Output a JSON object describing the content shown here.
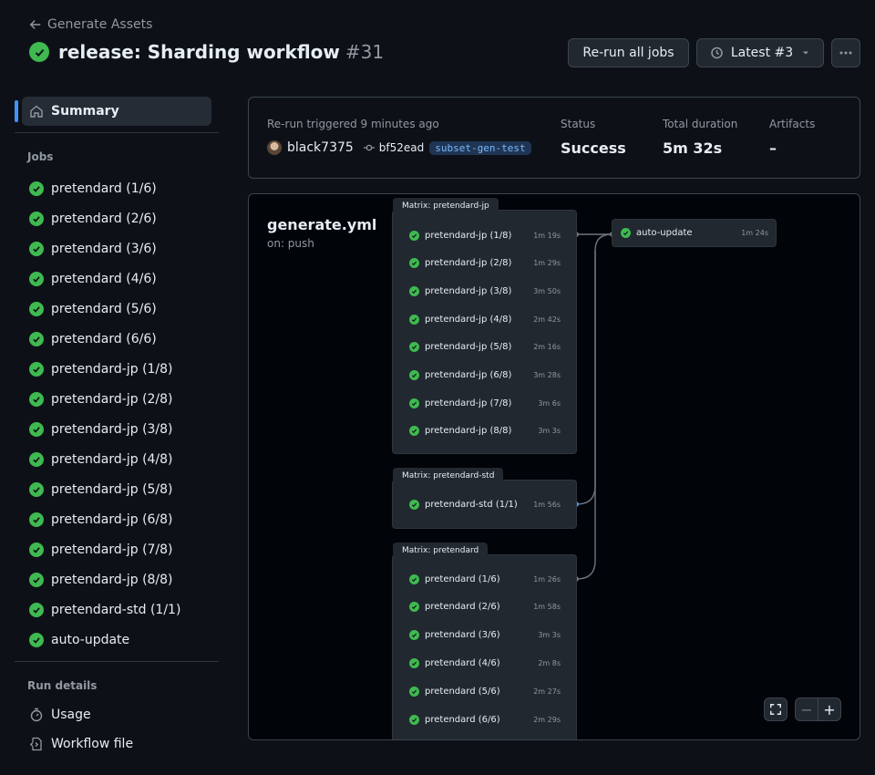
{
  "header": {
    "back_label": "Generate Assets",
    "title": "release: Sharding workflow",
    "run_number": "#31",
    "rerun_label": "Re-run all jobs",
    "latest_label": "Latest #3"
  },
  "sidebar": {
    "summary_label": "Summary",
    "jobs_heading": "Jobs",
    "jobs": [
      "pretendard (1/6)",
      "pretendard (2/6)",
      "pretendard (3/6)",
      "pretendard (4/6)",
      "pretendard (5/6)",
      "pretendard (6/6)",
      "pretendard-jp (1/8)",
      "pretendard-jp (2/8)",
      "pretendard-jp (3/8)",
      "pretendard-jp (4/8)",
      "pretendard-jp (5/8)",
      "pretendard-jp (6/8)",
      "pretendard-jp (7/8)",
      "pretendard-jp (8/8)",
      "pretendard-std (1/1)",
      "auto-update"
    ],
    "run_details_heading": "Run details",
    "usage_label": "Usage",
    "workflow_file_label": "Workflow file"
  },
  "summary": {
    "trigger_label": "Re-run triggered 9 minutes ago",
    "actor": "black7375",
    "commit": "bf52ead",
    "branch": "subset-gen-test",
    "status_label": "Status",
    "status_value": "Success",
    "duration_label": "Total duration",
    "duration_value": "5m 32s",
    "artifacts_label": "Artifacts",
    "artifacts_value": "–"
  },
  "graph": {
    "workflow_name": "generate.yml",
    "trigger": "on: push",
    "matrix_jp": {
      "label": "Matrix: pretendard-jp",
      "jobs": [
        {
          "name": "pretendard-jp (1/8)",
          "duration": "1m 19s"
        },
        {
          "name": "pretendard-jp (2/8)",
          "duration": "1m 29s"
        },
        {
          "name": "pretendard-jp (3/8)",
          "duration": "3m 50s"
        },
        {
          "name": "pretendard-jp (4/8)",
          "duration": "2m 42s"
        },
        {
          "name": "pretendard-jp (5/8)",
          "duration": "2m 16s"
        },
        {
          "name": "pretendard-jp (6/8)",
          "duration": "3m 28s"
        },
        {
          "name": "pretendard-jp (7/8)",
          "duration": "3m 6s"
        },
        {
          "name": "pretendard-jp (8/8)",
          "duration": "3m 3s"
        }
      ]
    },
    "matrix_std": {
      "label": "Matrix: pretendard-std",
      "jobs": [
        {
          "name": "pretendard-std (1/1)",
          "duration": "1m 56s"
        }
      ]
    },
    "matrix_base": {
      "label": "Matrix: pretendard",
      "jobs": [
        {
          "name": "pretendard (1/6)",
          "duration": "1m 26s"
        },
        {
          "name": "pretendard (2/6)",
          "duration": "1m 58s"
        },
        {
          "name": "pretendard (3/6)",
          "duration": "3m 3s"
        },
        {
          "name": "pretendard (4/6)",
          "duration": "2m 8s"
        },
        {
          "name": "pretendard (5/6)",
          "duration": "2m 27s"
        },
        {
          "name": "pretendard (6/6)",
          "duration": "2m 29s"
        }
      ]
    },
    "auto_update": {
      "name": "auto-update",
      "duration": "1m 24s"
    },
    "zoom_out": "−",
    "zoom_in": "+"
  }
}
